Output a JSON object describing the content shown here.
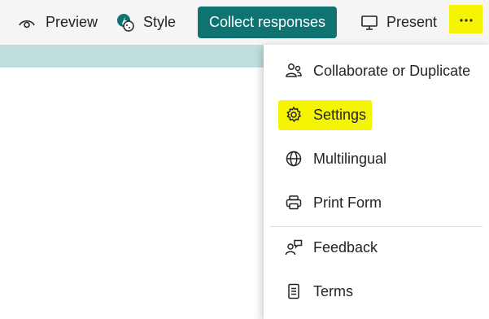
{
  "toolbar": {
    "preview_label": "Preview",
    "style_label": "Style",
    "collect_label": "Collect responses",
    "present_label": "Present",
    "more_label": "···"
  },
  "menu": {
    "items": [
      {
        "label": "Collaborate or Duplicate",
        "icon": "people-icon"
      },
      {
        "label": "Settings",
        "icon": "gear-icon",
        "highlighted": true
      },
      {
        "label": "Multilingual",
        "icon": "globe-icon"
      },
      {
        "label": "Print Form",
        "icon": "printer-icon"
      },
      {
        "label": "Feedback",
        "icon": "feedback-icon"
      },
      {
        "label": "Terms",
        "icon": "document-icon"
      }
    ]
  },
  "colors": {
    "accent": "#0f7471",
    "highlight": "#f5f503",
    "band": "#c1dede"
  }
}
